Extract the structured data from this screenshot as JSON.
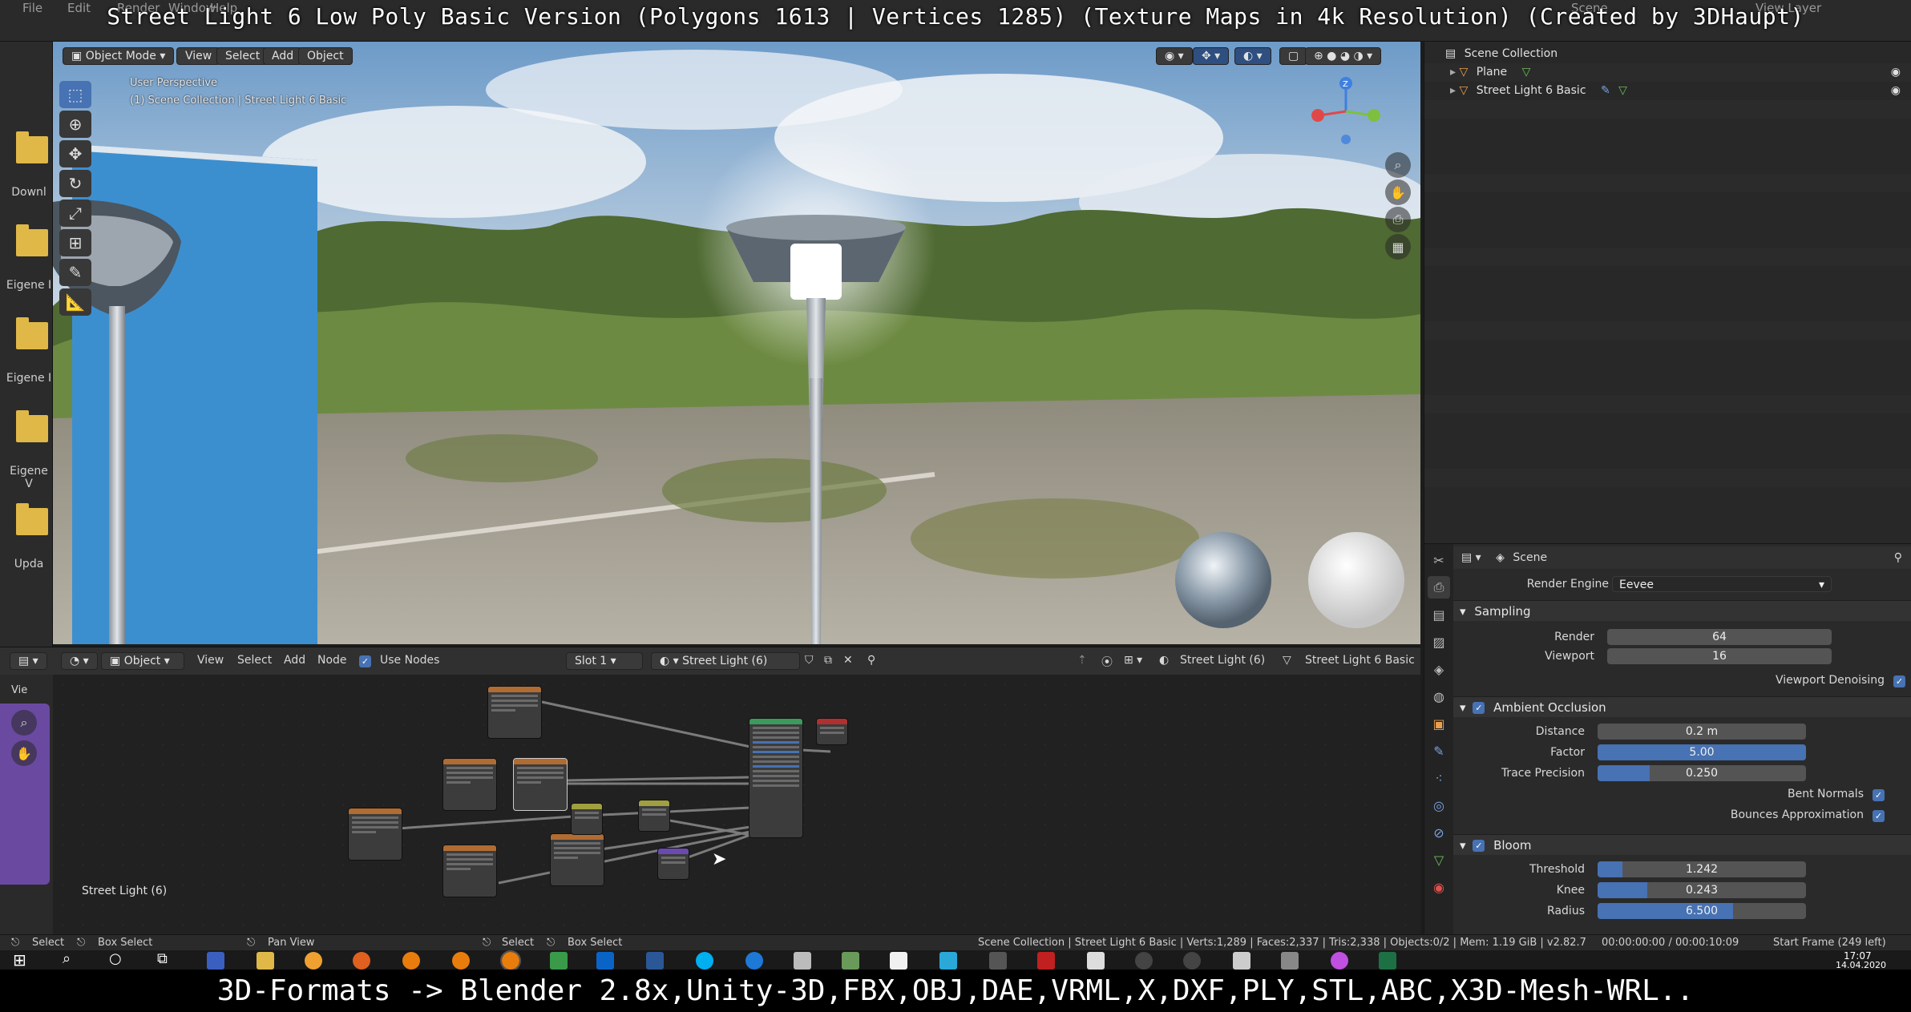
{
  "caption_top": "Street Light 6 Low Poly Basic Version (Polygons 1613 | Vertices 1285) (Texture Maps in 4k Resolution) (Created by 3DHaupt)",
  "caption_bottom": "3D-Formats -> Blender 2.8x,Unity-3D,FBX,OBJ,DAE,VRML,X,DXF,PLY,STL,ABC,X3D-Mesh-WRL..",
  "top_menu": [
    "File",
    "Edit",
    "Render",
    "Window",
    "Help"
  ],
  "top_right": {
    "scene": "Scene",
    "view_layer": "View Layer"
  },
  "file_browser": {
    "items": [
      "Downl",
      "Eigene I",
      "Eigene I",
      "Eigene V",
      "Upda"
    ]
  },
  "viewport": {
    "header": {
      "mode": "Object Mode",
      "view": "View",
      "select": "Select",
      "add": "Add",
      "object": "Object"
    },
    "info_line1": "User Perspective",
    "info_line2": "(1) Scene Collection | Street Light 6 Basic",
    "gizmo": {
      "x_color": "#e04848",
      "y_color": "#7fbf3f",
      "z_color": "#3f7fe0",
      "z_label": "Z"
    }
  },
  "outliner": {
    "root": "Scene Collection",
    "items": [
      {
        "label": "Plane",
        "icon": "mesh-icon"
      },
      {
        "label": "Street Light 6 Basic",
        "icon": "mesh-icon"
      }
    ]
  },
  "properties": {
    "breadcrumb": "Scene",
    "render_engine_label": "Render Engine",
    "render_engine_value": "Eevee",
    "sampling": {
      "title": "Sampling",
      "render_label": "Render",
      "render_value": "64",
      "viewport_label": "Viewport",
      "viewport_value": "16",
      "denoise_label": "Viewport Denoising"
    },
    "ambient_occlusion": {
      "title": "Ambient Occlusion",
      "distance_label": "Distance",
      "distance_value": "0.2 m",
      "factor_label": "Factor",
      "factor_value": "5.00",
      "factor_fill": 1.0,
      "trace_label": "Trace Precision",
      "trace_value": "0.250",
      "trace_fill": 0.25,
      "bent_label": "Bent Normals",
      "bounces_label": "Bounces Approximation"
    },
    "bloom": {
      "title": "Bloom",
      "threshold_label": "Threshold",
      "threshold_value": "1.242",
      "threshold_fill": 0.12,
      "knee_label": "Knee",
      "knee_value": "0.243",
      "knee_fill": 0.24,
      "radius_label": "Radius",
      "radius_value": "6.500",
      "radius_fill": 0.65
    }
  },
  "node_editor": {
    "header": {
      "object": "Object",
      "view": "View",
      "select": "Select",
      "add": "Add",
      "node": "Node",
      "use_nodes": "Use Nodes",
      "slot": "Slot 1",
      "material": "Street Light (6)",
      "material_right": "Street Light (6)",
      "object_right": "Street Light 6 Basic"
    },
    "label": "Street Light (6)",
    "left_label": "Vie"
  },
  "statusbar": {
    "select": "Select",
    "box_select": "Box Select",
    "pan_view": "Pan View",
    "select2": "Select",
    "box_select2": "Box Select",
    "stats": "Scene Collection | Street Light 6 Basic | Verts:1,289 | Faces:2,337 | Tris:2,338 | Objects:0/2 | Mem: 1.19 GiB | v2.82.7",
    "time": "00:00:00:00 / 00:00:10:09",
    "frame": "Start Frame (249 left)"
  },
  "taskbar": {
    "clock": "17:07",
    "date": "14.04.2020"
  },
  "colors": {
    "accent": "#4772b3",
    "folder": "#e0b848"
  }
}
